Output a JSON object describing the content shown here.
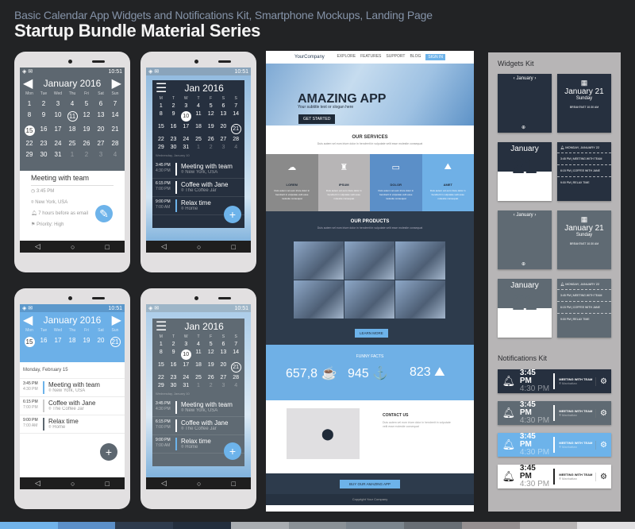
{
  "header": {
    "subtitle": "Basic Calendar App Widgets and Notifications Kit, Smartphone Mockups, Landing Page",
    "title": "Startup Bundle Material Series"
  },
  "status_time": "10:51",
  "phone1": {
    "month": "January 2016",
    "weekdays": [
      "Mon",
      "Tue",
      "Wed",
      "Thu",
      "Fri",
      "Sat",
      "Sun"
    ],
    "days": [
      "1",
      "2",
      "3",
      "4",
      "5",
      "6",
      "7",
      "8",
      "9",
      "10",
      "11",
      "12",
      "13",
      "14",
      "15",
      "16",
      "17",
      "18",
      "19",
      "20",
      "21",
      "22",
      "23",
      "24",
      "25",
      "26",
      "27",
      "28",
      "29",
      "30",
      "31",
      "1",
      "2",
      "3",
      "4"
    ],
    "selected": "15",
    "ringed": "11",
    "event_title": "Meeting with team",
    "time": "3:45 PM",
    "location": "New York, USA",
    "reminder": "7 hours before as email",
    "priority": "Priority: High"
  },
  "phone2": {
    "month": "Jan 2016",
    "weekdays": [
      "M",
      "T",
      "W",
      "T",
      "F",
      "S",
      "S"
    ],
    "selected": "10",
    "ringed": "21",
    "date_label": "Wednesday, January 10",
    "events": [
      {
        "start": "3:45 PM",
        "end": "4:30 PM",
        "title": "Meeting with team",
        "loc": "New York, USA"
      },
      {
        "start": "6:15 PM",
        "end": "7:00 PM",
        "title": "Coffee with Jane",
        "loc": "The Coffee Jar"
      },
      {
        "start": "9:00 PM",
        "end": "7:00 AM",
        "title": "Relax time",
        "loc": "Home"
      }
    ]
  },
  "phone3": {
    "month": "January 2016",
    "week": [
      "15",
      "16",
      "17",
      "18",
      "19",
      "20",
      "21"
    ],
    "date_label": "Monday, February 15"
  },
  "landing": {
    "brand": "YourCompany",
    "nav": [
      "EXPLORE",
      "FEATURES",
      "SUPPORT",
      "BLOG",
      "SIGN IN"
    ],
    "hero_title": "AMAZING APP",
    "hero_sub": "Your subtitle text or slogan here",
    "hero_btn": "GET STARTED",
    "services_title": "OUR SERVICES",
    "services": [
      {
        "name": "LOREM",
        "icon": "☁"
      },
      {
        "name": "IPSUM",
        "icon": "♜"
      },
      {
        "name": "DOLOR",
        "icon": "▭"
      },
      {
        "name": "AMET",
        "icon": "⛰"
      }
    ],
    "products_title": "OUR PRODUCTS",
    "learn_more": "LEARN MORE",
    "facts_title": "FUNNY FACTS",
    "facts": [
      {
        "value": "657,8",
        "icon": "☕"
      },
      {
        "value": "945",
        "icon": "⚓"
      },
      {
        "value": "823",
        "icon": "⛰"
      }
    ],
    "contact_title": "CONTACT US",
    "buy_btn": "BUY OUR AMAZING APP",
    "copyright": "Copyright Your Company",
    "lorem": "Duis autem vel eum iriure dolor in hendrerit in vulputate velit esse molestie consequat"
  },
  "widgets": {
    "title": "Widgets Kit",
    "month": "January",
    "date": "January 21",
    "weekday": "Sunday",
    "breakfast": "BREAKFAST 10:30 AM",
    "day": "21",
    "agenda_date": "MONDAY, JANUARY 22",
    "agenda": [
      {
        "t": "3:45 PM",
        "title": "MEETING WITH TEAM",
        "loc": "Manhattan"
      },
      {
        "t": "6:15 PM",
        "title": "COFFEE WITH JANE",
        "loc": "The Coffee Jar"
      },
      {
        "t": "9:00 PM",
        "title": "RELAX TIME",
        "loc": "Home"
      }
    ]
  },
  "notifications": {
    "title": "Notifications Kit",
    "start": "3:45 PM",
    "end": "4:30 PM",
    "event": "MEETING WITH TEAM",
    "loc": "Manhattan"
  },
  "palette": [
    "#71b3ea",
    "#5b8fc8",
    "#2e3b4d",
    "#232e3d",
    "#a9adb1",
    "#8a9196",
    "#7b858d",
    "#686e74",
    "#958f90",
    "#b7b4b4",
    "#e0dfe1"
  ]
}
